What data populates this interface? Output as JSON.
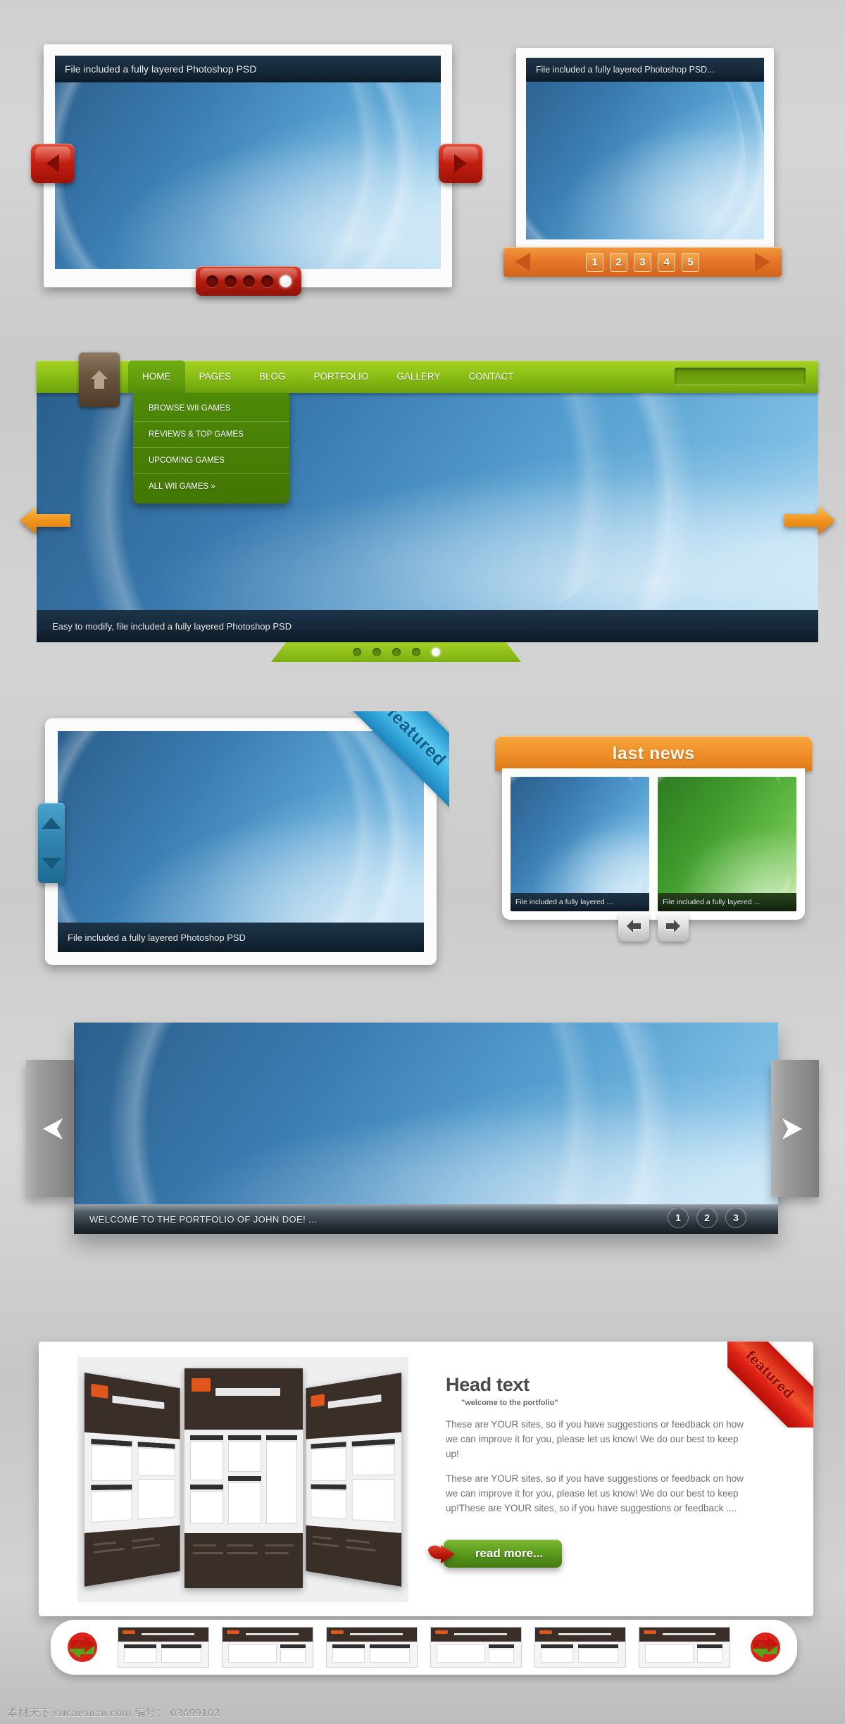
{
  "panel_a": {
    "caption": "File included a fully layered Photoshop PSD",
    "prev_label": "◀",
    "next_label": "▶",
    "dots": [
      "1",
      "2",
      "3",
      "4",
      "5"
    ],
    "active_dot": 5
  },
  "panel_b": {
    "caption": "File included a fully layered Photoshop PSD...",
    "prev_label": "◀",
    "next_label": "▶",
    "pages": [
      "1",
      "2",
      "3",
      "4",
      "5"
    ]
  },
  "nav": {
    "home_icon": "house-icon",
    "items": [
      {
        "label": "HOME",
        "active": true
      },
      {
        "label": "PAGES",
        "active": false
      },
      {
        "label": "BLOG",
        "active": false
      },
      {
        "label": "PORTFOLIO",
        "active": false
      },
      {
        "label": "GALLERY",
        "active": false
      },
      {
        "label": "CONTACT",
        "active": false
      }
    ],
    "search_value": "",
    "search_placeholder": "",
    "dropdown": [
      "BROWSE WII GAMES",
      "REVIEWS & TOP GAMES",
      "UPCOMING GAMES",
      "ALL WII GAMES »"
    ],
    "hero_caption": "Easy to modify, file included a fully layered Photoshop PSD",
    "dots": [
      "1",
      "2",
      "3",
      "4",
      "5"
    ],
    "active_dot": 5
  },
  "panel_d": {
    "caption": "File included a fully layered Photoshop PSD",
    "ribbon": "featured",
    "scroll_up": "▲",
    "scroll_down": "▼"
  },
  "last_news": {
    "title": "last news",
    "items": [
      {
        "caption": "File included a fully layered ...",
        "color": "blue"
      },
      {
        "caption": "File included a fully layered ...",
        "color": "green"
      }
    ],
    "prev_label": "◀",
    "next_label": "▶"
  },
  "portfolio": {
    "caption": "WELCOME TO THE PORTFOLIO OF JOHN DOE! ...",
    "pages": [
      "1",
      "2",
      "3"
    ],
    "prev_label": "◀",
    "next_label": "▶"
  },
  "head_section": {
    "heading": "Head text",
    "subheading": "\"welcome to the portfolio\"",
    "paragraph_1": "These are YOUR sites, so if you have suggestions or feedback on how we can improve it for you, please let us know! We do our best to keep up!",
    "paragraph_2": "These are YOUR sites, so if you have suggestions or feedback on how we can improve it for you, please let us know! We do our best to keep up!These are YOUR sites, so if you have suggestions or feedback ....",
    "read_more": "read more...",
    "ribbon": "featured"
  },
  "carousel": {
    "prev_icon": "recycle-arrow-icon",
    "next_icon": "recycle-arrow-icon",
    "thumb_count": 6
  },
  "footer": {
    "watermark": "素材天下  sucaisucai.com   编号： 03699103"
  },
  "colors": {
    "green_nav": "#8cc017",
    "orange": "#ef8f27",
    "red": "#c61f10",
    "blue": "#3aafe0",
    "photo_blue": "#3a7bb0"
  }
}
